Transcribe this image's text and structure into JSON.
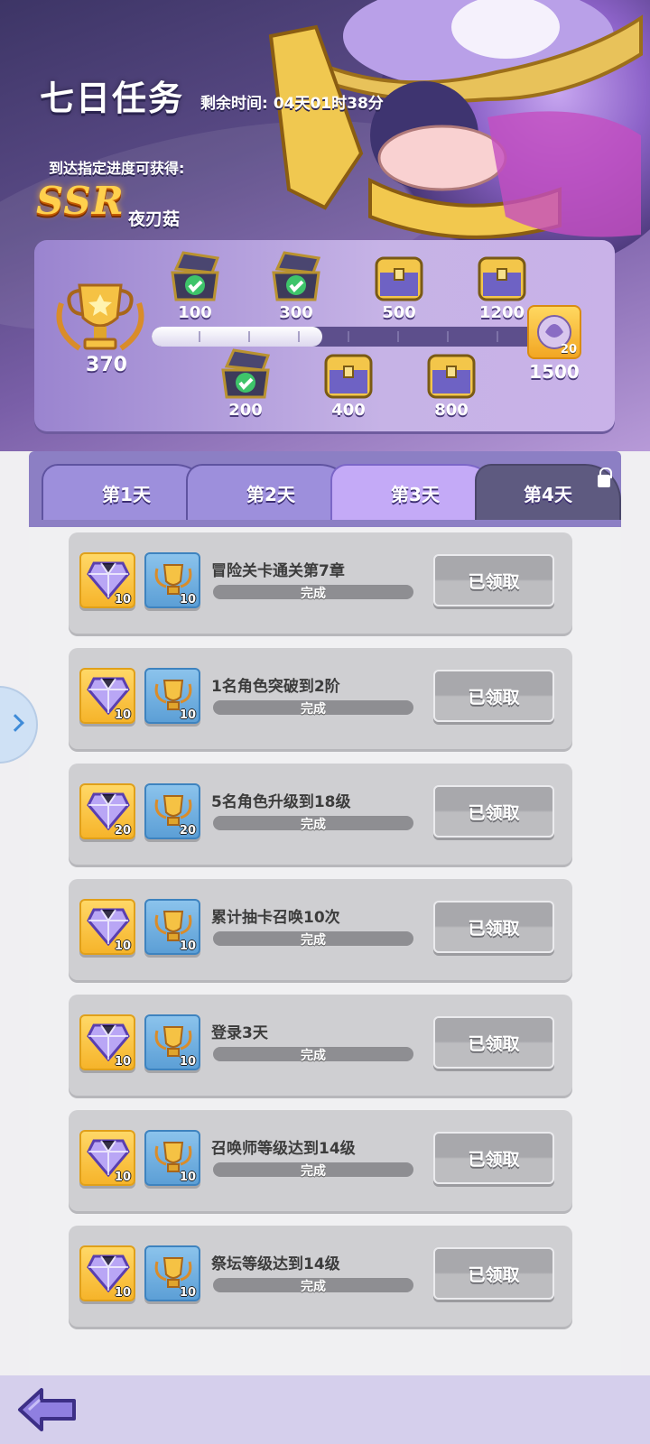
{
  "header": {
    "title": "七日任务",
    "time_label": "剩余时间:",
    "time_value": "04天01时38分",
    "reward_hint": "到达指定进度可获得:",
    "ssr_label": "SSR",
    "character_name": "夜刃菇"
  },
  "progress": {
    "current": "370",
    "fill_fraction": 0.41,
    "milestones_top": [
      {
        "label": "100",
        "claimed": true
      },
      {
        "label": "300",
        "claimed": true
      },
      {
        "label": "500",
        "claimed": false
      },
      {
        "label": "1200",
        "claimed": false
      }
    ],
    "milestones_bottom": [
      {
        "label": "200",
        "claimed": true
      },
      {
        "label": "400",
        "claimed": false
      },
      {
        "label": "800",
        "claimed": false
      }
    ],
    "final": {
      "label": "1500",
      "reward_count": "20"
    }
  },
  "tabs": [
    {
      "label": "第1天",
      "state": "normal"
    },
    {
      "label": "第2天",
      "state": "normal"
    },
    {
      "label": "第3天",
      "state": "active"
    },
    {
      "label": "第4天",
      "state": "locked"
    }
  ],
  "tasks": [
    {
      "title": "冒险关卡通关第7章",
      "gem": "10",
      "trophy": "10",
      "status": "完成",
      "button": "已领取"
    },
    {
      "title": "1名角色突破到2阶",
      "gem": "10",
      "trophy": "10",
      "status": "完成",
      "button": "已领取"
    },
    {
      "title": "5名角色升级到18级",
      "gem": "20",
      "trophy": "20",
      "status": "完成",
      "button": "已领取"
    },
    {
      "title": "累计抽卡召唤10次",
      "gem": "10",
      "trophy": "10",
      "status": "完成",
      "button": "已领取"
    },
    {
      "title": "登录3天",
      "gem": "10",
      "trophy": "10",
      "status": "完成",
      "button": "已领取"
    },
    {
      "title": "召唤师等级达到14级",
      "gem": "10",
      "trophy": "10",
      "status": "完成",
      "button": "已领取"
    },
    {
      "title": "祭坛等级达到14级",
      "gem": "10",
      "trophy": "10",
      "status": "完成",
      "button": "已领取"
    }
  ],
  "colors": {
    "accent": "#8c7fc4",
    "active_tab": "#c4aaf7",
    "gem_bg": "#f6b42a",
    "trophy_bg": "#5c9fd6"
  },
  "icons": {
    "back": "back-arrow-icon",
    "side": "chevron-right-icon",
    "lock": "lock-icon"
  }
}
